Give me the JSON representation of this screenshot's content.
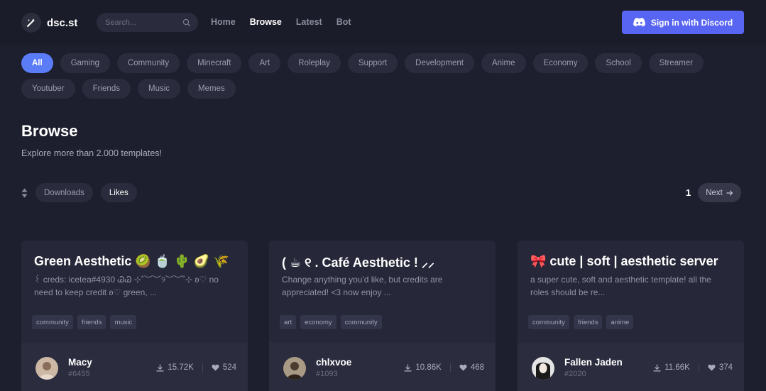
{
  "app": {
    "name": "dsc.st"
  },
  "search": {
    "placeholder": "Search..."
  },
  "nav": [
    {
      "label": "Home",
      "active": false
    },
    {
      "label": "Browse",
      "active": true
    },
    {
      "label": "Latest",
      "active": false
    },
    {
      "label": "Bot",
      "active": false
    }
  ],
  "signin": {
    "label": "Sign in with Discord"
  },
  "categories": [
    {
      "label": "All",
      "active": true
    },
    {
      "label": "Gaming"
    },
    {
      "label": "Community"
    },
    {
      "label": "Minecraft"
    },
    {
      "label": "Art"
    },
    {
      "label": "Roleplay"
    },
    {
      "label": "Support"
    },
    {
      "label": "Development"
    },
    {
      "label": "Anime"
    },
    {
      "label": "Economy"
    },
    {
      "label": "School"
    },
    {
      "label": "Streamer"
    },
    {
      "label": "Youtuber"
    },
    {
      "label": "Friends"
    },
    {
      "label": "Music"
    },
    {
      "label": "Memes"
    }
  ],
  "page": {
    "title": "Browse",
    "subtitle": "Explore more than 2.000 templates!"
  },
  "sort": {
    "options": [
      {
        "label": "Downloads",
        "active": false
      },
      {
        "label": "Likes",
        "active": true
      }
    ]
  },
  "pager": {
    "current": "1",
    "next_label": "Next"
  },
  "cards": [
    {
      "title": "Green Aesthetic 🥝 🍵 🌵 🥑 🌾",
      "description": "꒰ creds: icetea#4930 ᏊᏊ ⊹˚︶︶୨︶︶˚⊹ ʚ♡ no need to keep credit ʚ♡ green, ...",
      "tags": [
        "community",
        "friends",
        "music"
      ],
      "author": "Macy",
      "tag": "#6455",
      "downloads": "15.72K",
      "likes": "524"
    },
    {
      "title": "( ☕ ୧ . Café Aesthetic ! ⸝⸝",
      "description": "Change anything you'd like, but credits are appreciated! <3 now enjoy ...",
      "tags": [
        "art",
        "economy",
        "community"
      ],
      "author": "chlxvoe",
      "tag": "#1093",
      "downloads": "10.86K",
      "likes": "468"
    },
    {
      "title": "🎀 cute | soft | aesthetic server",
      "description": "a super cute, soft and aesthetic template! all the roles should be re...",
      "tags": [
        "community",
        "friends",
        "anime"
      ],
      "author": "Fallen Jaden",
      "tag": "#2020",
      "downloads": "11.66K",
      "likes": "374"
    }
  ],
  "colors": {
    "background": "#1e1f2e",
    "accent": "#5865f2",
    "active_chip": "#5a7cf6"
  }
}
